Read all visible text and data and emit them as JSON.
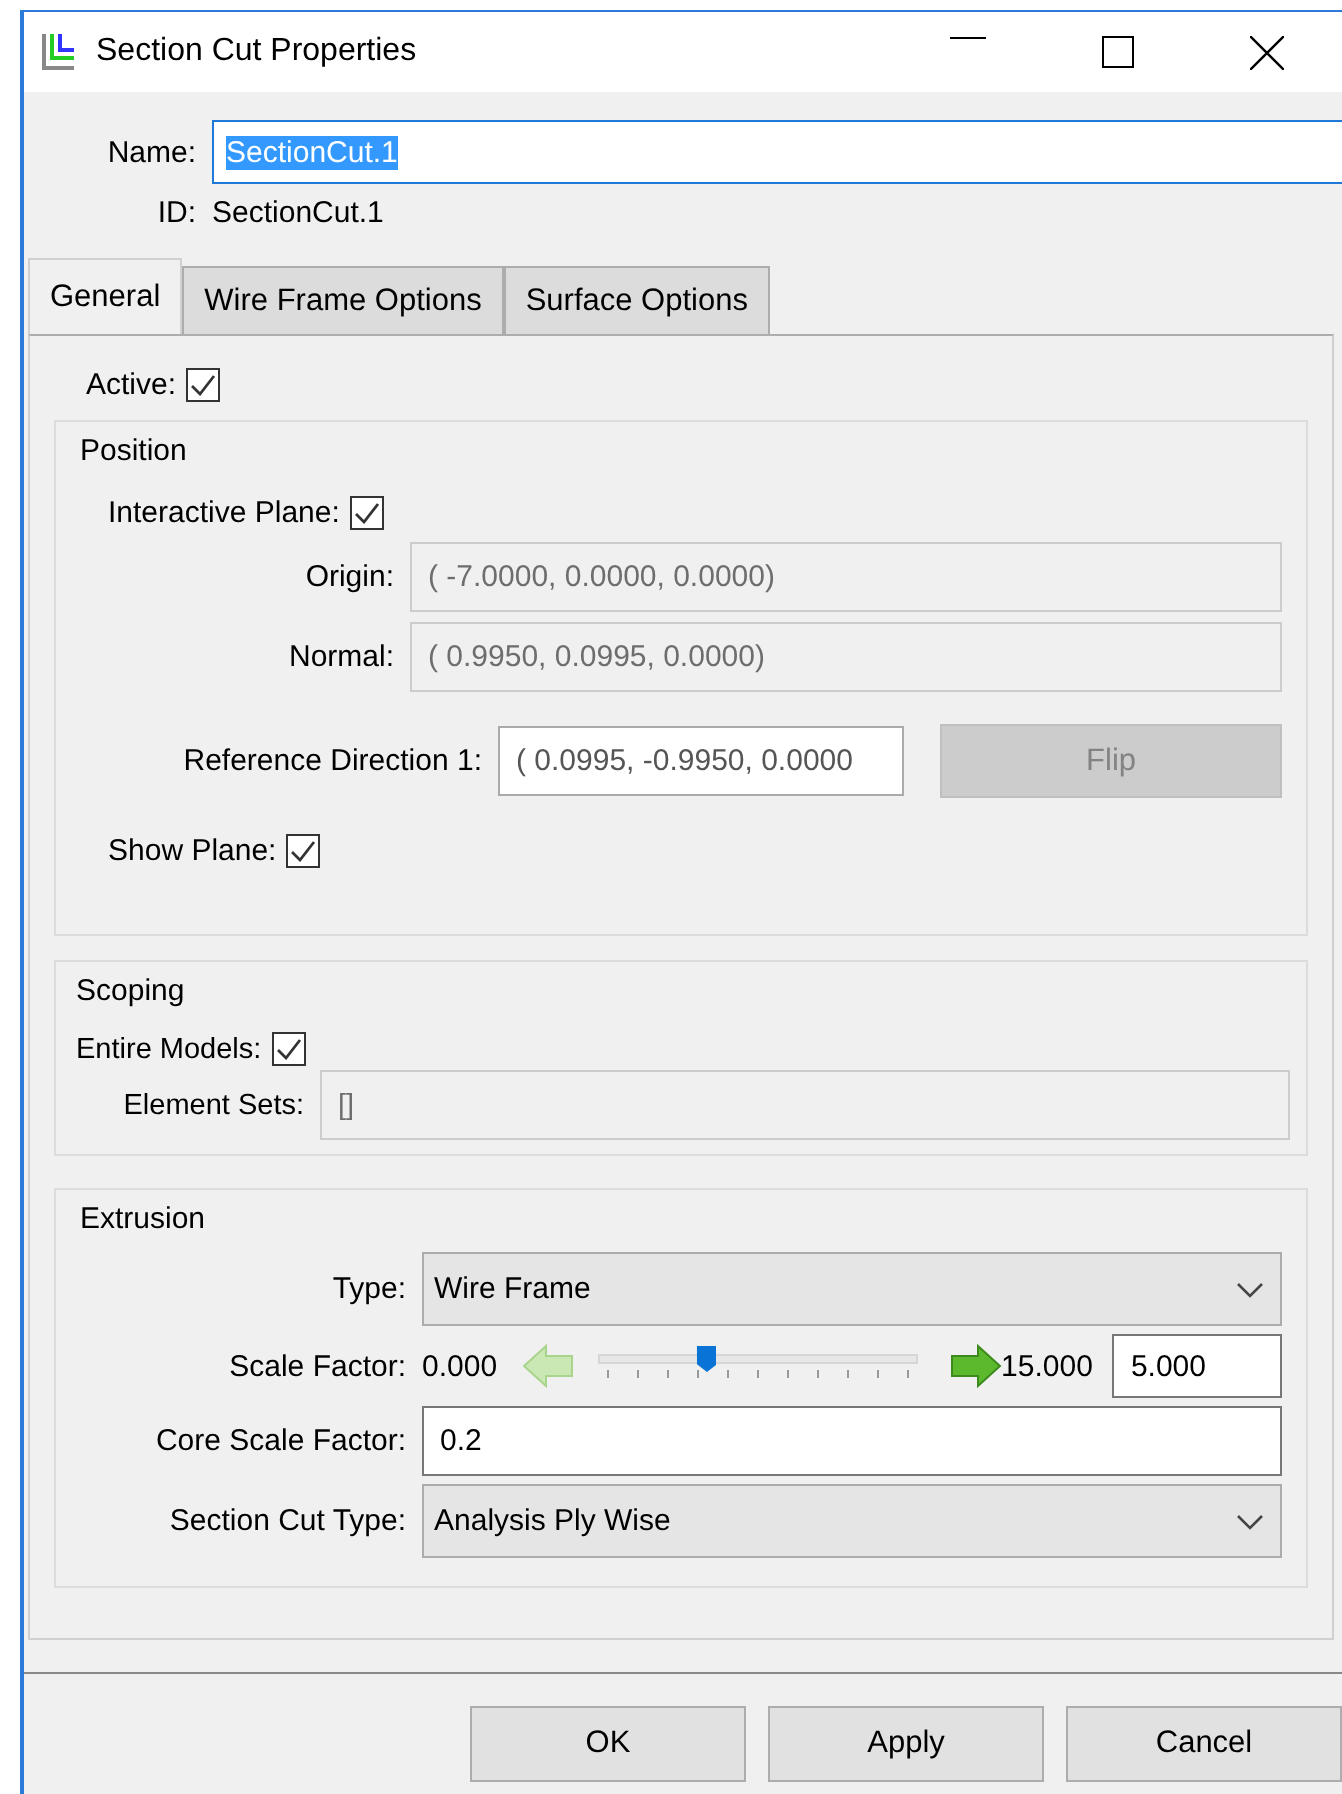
{
  "window": {
    "title": "Section Cut Properties"
  },
  "name": {
    "label": "Name:",
    "value": "SectionCut.1",
    "text_selected": true
  },
  "id": {
    "label": "ID:",
    "value": "SectionCut.1"
  },
  "tabs": [
    {
      "label": "General",
      "selected": true
    },
    {
      "label": "Wire Frame Options",
      "selected": false
    },
    {
      "label": "Surface Options",
      "selected": false
    }
  ],
  "active": {
    "label": "Active:",
    "checked": true
  },
  "position": {
    "title": "Position",
    "interactive_plane": {
      "label": "Interactive Plane:",
      "checked": true
    },
    "origin": {
      "label": "Origin:",
      "value": "( -7.0000, 0.0000, 0.0000)",
      "disabled": true
    },
    "normal": {
      "label": "Normal:",
      "value": "( 0.9950, 0.0995, 0.0000)",
      "disabled": true
    },
    "reference_direction": {
      "label": "Reference Direction 1:",
      "value": "( 0.0995, -0.9950, 0.0000",
      "disabled": false
    },
    "flip_button": {
      "label": "Flip",
      "disabled": true
    },
    "show_plane": {
      "label": "Show Plane:",
      "checked": true
    }
  },
  "scoping": {
    "title": "Scoping",
    "entire_models": {
      "label": "Entire Models:",
      "checked": true
    },
    "element_sets": {
      "label": "Element Sets:",
      "value": "[]",
      "disabled": true
    }
  },
  "extrusion": {
    "title": "Extrusion",
    "type": {
      "label": "Type:",
      "value": "Wire Frame"
    },
    "scale_factor": {
      "label": "Scale Factor:",
      "min_label": "0.000",
      "max_label": "15.000",
      "level": 0.333,
      "value": "5.000"
    },
    "core_scale_factor": {
      "label": "Core Scale Factor:",
      "value": "0.2"
    },
    "section_cut_type": {
      "label": "Section Cut Type:",
      "value": "Analysis Ply Wise"
    }
  },
  "buttons": [
    {
      "label": "OK"
    },
    {
      "label": "Apply"
    },
    {
      "label": "Cancel"
    }
  ]
}
